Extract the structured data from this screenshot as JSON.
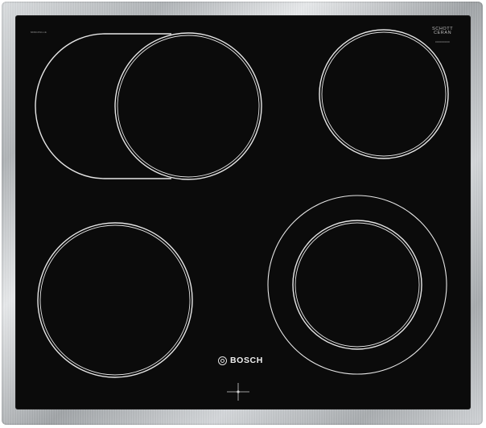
{
  "image": {
    "subject": "ceramic hob",
    "brand": "BOSCH",
    "supplier_mark": [
      "SCHOTT",
      "CERAN"
    ],
    "model_text": "NKN6450xxE",
    "serial_text": "000000000",
    "colors": {
      "glass": "#0b0b0b",
      "zone_outline": "#e8e8e8",
      "frame": "#b7bbbe",
      "brand_text": "#f0f0f0"
    }
  }
}
